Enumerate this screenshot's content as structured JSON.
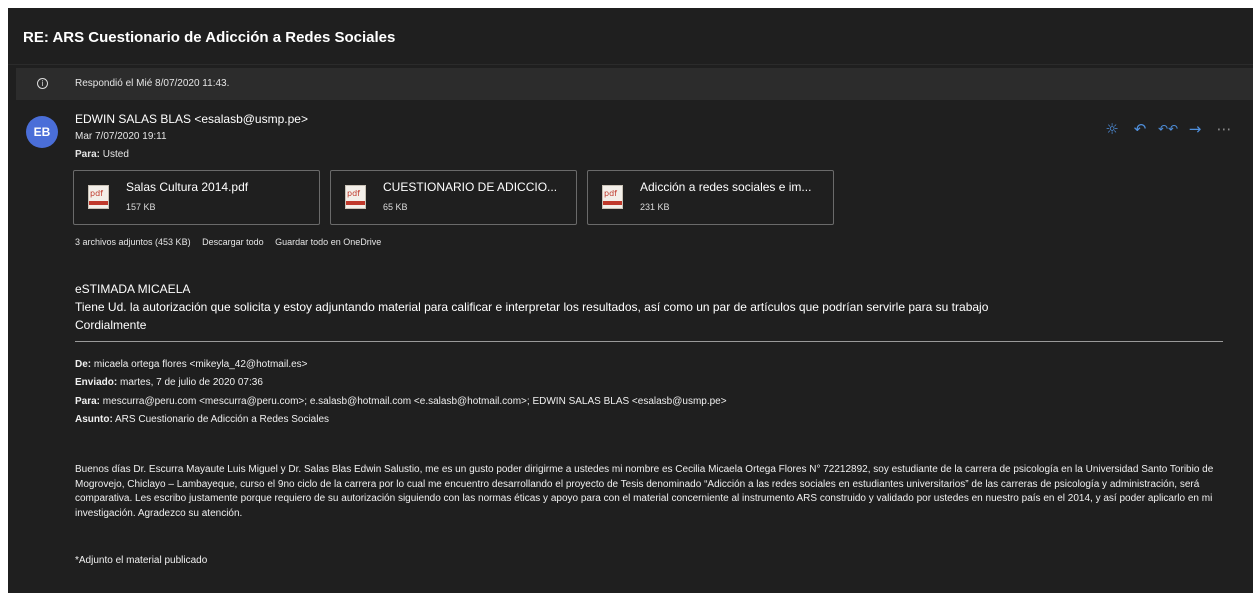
{
  "subject": "RE: ARS Cuestionario de Adicción a Redes Sociales",
  "info": {
    "icon": "info-icon",
    "text": "Respondió el Mié 8/07/2020 11:43."
  },
  "message": {
    "avatar_initials": "EB",
    "sender": "EDWIN SALAS BLAS <esalasb@usmp.pe>",
    "date": "Mar 7/07/2020 19:11",
    "to_label": "Para:",
    "to_value": "Usted",
    "actions": [
      {
        "name": "sun-icon",
        "glyph": "☼"
      },
      {
        "name": "reply-icon",
        "glyph": "↶"
      },
      {
        "name": "reply-all-icon",
        "glyph": "↶↶"
      },
      {
        "name": "forward-icon",
        "glyph": "→"
      },
      {
        "name": "more-icon",
        "glyph": "⋯"
      }
    ]
  },
  "attachments": [
    {
      "name": "Salas Cultura 2014.pdf",
      "size": "157 KB",
      "icon": "pdf-icon"
    },
    {
      "name": "CUESTIONARIO DE ADICCIO...",
      "size": "65 KB",
      "icon": "pdf-icon"
    },
    {
      "name": "Adicción a redes sociales e im...",
      "size": "231 KB",
      "icon": "pdf-icon"
    }
  ],
  "attachments_summary": {
    "count_text": "3 archivos adjuntos (453 KB)",
    "download_all": "Descargar todo",
    "save_onedrive": "Guardar todo en OneDrive"
  },
  "body": {
    "greeting": "eSTIMADA MICAELA",
    "line1": "Tiene Ud. la autorización que solicita y estoy adjuntando material para calificar e interpretar los resultados, así como un par de artículos que podrían servirle para su trabajo",
    "closing": "Cordialmente"
  },
  "quoted": {
    "from_label": "De:",
    "from_value": "micaela ortega flores <mikeyla_42@hotmail.es>",
    "sent_label": "Enviado:",
    "sent_value": "martes, 7 de julio de 2020 07:36",
    "to_label": "Para:",
    "to_value": "mescurra@peru.com <mescurra@peru.com>; e.salasb@hotmail.com <e.salasb@hotmail.com>; EDWIN SALAS BLAS <esalasb@usmp.pe>",
    "subject_label": "Asunto:",
    "subject_value": "ARS Cuestionario de Adicción a Redes Sociales",
    "paragraph": "Buenos días Dr. Escurra Mayaute Luis Miguel y Dr. Salas Blas Edwin Salustio, me es un gusto poder dirigirme a ustedes mi nombre es Cecilia Micaela Ortega Flores N° 72212892, soy estudiante de la carrera de psicología en la Universidad Santo Toribio de Mogrovejo, Chiclayo – Lambayeque, curso el 9no ciclo de la carrera por lo cual me encuentro desarrollando el proyecto de Tesis denominado “Adicción a las redes sociales en estudiantes universitarios” de las carreras de psicología y administración, será comparativa. Les escribo justamente porque requiero de su autorización siguiendo con las normas éticas y apoyo para con el material concerniente al instrumento ARS construido y validado por ustedes en nuestro país en el 2014, y así poder aplicarlo en mi investigación. Agradezco su atención.",
    "footnote": "*Adjunto el material publicado"
  },
  "colors": {
    "background": "#1f1f1f",
    "accent": "#4f8fdc",
    "avatar": "#4a6ed8"
  }
}
